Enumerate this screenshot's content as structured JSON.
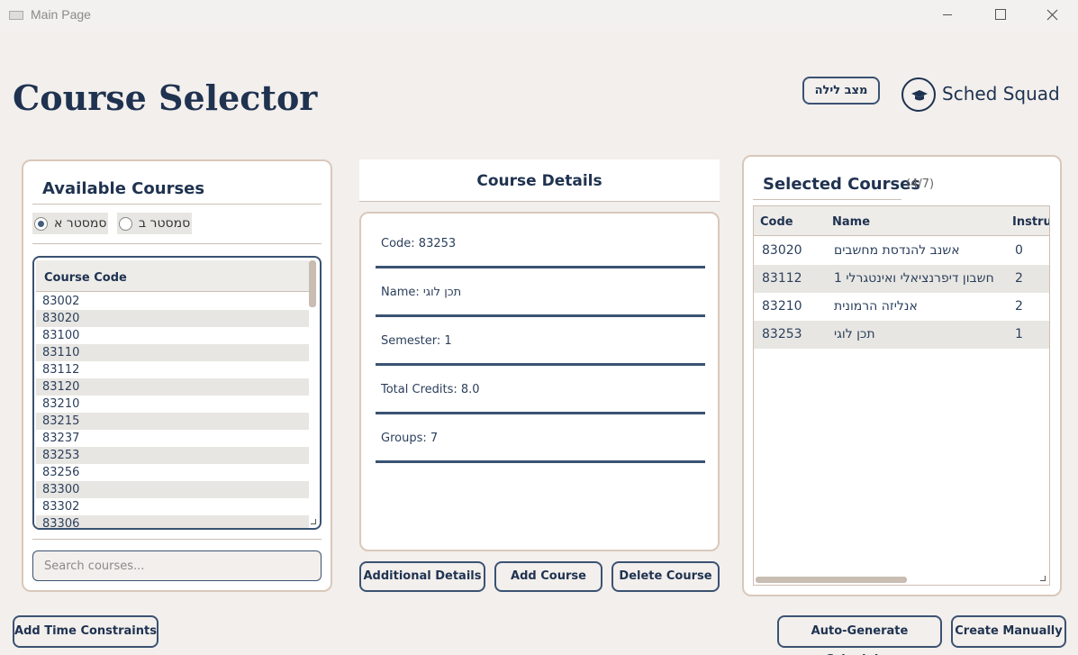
{
  "window": {
    "title": "Main Page"
  },
  "header": {
    "title": "Course Selector",
    "night_mode_label": "מצב לילה",
    "brand": "Sched Squad"
  },
  "available": {
    "title": "Available Courses",
    "semester_a": "סמסטר א",
    "semester_b": "סמסטר ב",
    "column_header": "Course Code",
    "codes": [
      "83002",
      "83020",
      "83100",
      "83110",
      "83112",
      "83120",
      "83210",
      "83215",
      "83237",
      "83253",
      "83256",
      "83300",
      "83302",
      "83306"
    ],
    "search_placeholder": "Search courses..."
  },
  "details": {
    "title": "Course Details",
    "code": "Code: 83253",
    "name": "Name: תכן לוגי",
    "semester": "Semester: 1",
    "credits": "Total Credits: 8.0",
    "groups": "Groups: 7",
    "additional_label": "Additional Details",
    "add_label": "Add Course",
    "delete_label": "Delete Course"
  },
  "selected": {
    "title": "Selected Courses",
    "count": "(4/7)",
    "headers": {
      "code": "Code",
      "name": "Name",
      "instructor": "Instruc"
    },
    "rows": [
      {
        "code": "83020",
        "name": "אשנב להנדסת מחשבים",
        "instructors": "0"
      },
      {
        "code": "83112",
        "name": "חשבון דיפרנציאלי ואינטגרלי 1",
        "instructors": "2"
      },
      {
        "code": "83210",
        "name": "אנליזה הרמונית",
        "instructors": "2"
      },
      {
        "code": "83253",
        "name": "תכן לוגי",
        "instructors": "1"
      }
    ]
  },
  "footer": {
    "time_constraints_label": "Add Time Constraints",
    "auto_generate_label": "Auto-Generate Schedules",
    "create_manually_label": "Create Manually"
  }
}
